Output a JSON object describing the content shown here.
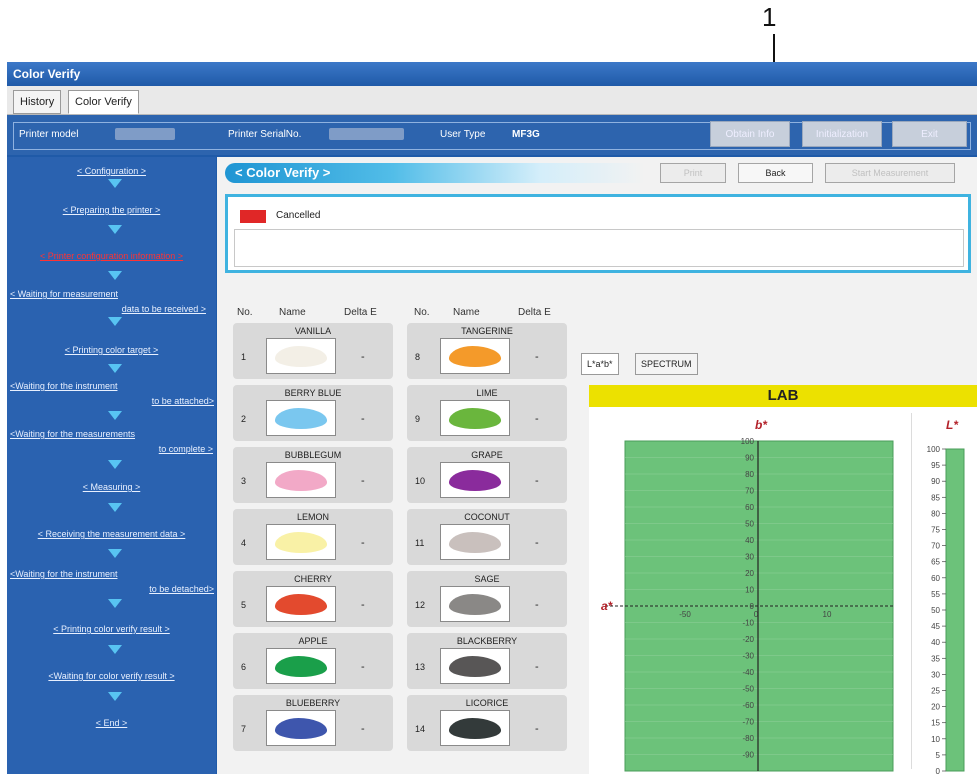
{
  "callout": {
    "number": "1"
  },
  "window": {
    "title": "Color Verify"
  },
  "tabs": [
    "History",
    "Color Verify"
  ],
  "infobar": {
    "printer_model_label": "Printer model",
    "printer_serial_label": "Printer SerialNo.",
    "user_type_label": "User Type",
    "user_type_value": "MF3G",
    "buttons": [
      "Obtain Info",
      "Initialization",
      "Exit"
    ]
  },
  "sidebar": {
    "steps": [
      "<   Configuration   >",
      "<  Preparing the printer  >",
      "< Printer configuration information >",
      "< Waiting for measurement",
      "data to be received   >",
      "<  Printing color target  >",
      "<Waiting for the instrument",
      "to be attached>",
      "<Waiting for the measurements",
      "to complete >",
      "<     Measuring     >",
      "< Receiving the measurement data >",
      "<Waiting for the instrument",
      "to be detached>",
      "< Printing color verify result >",
      "<Waiting for color verify result >",
      "<      End      >"
    ]
  },
  "content": {
    "banner": "< Color Verify >",
    "buttons": {
      "print": "Print",
      "back": "Back",
      "start": "Start Measurement"
    },
    "status": {
      "text": "Cancelled",
      "color": "#e02727"
    },
    "headers": {
      "no": "No.",
      "name": "Name",
      "delta": "Delta E"
    }
  },
  "swatches": [
    {
      "no": "1",
      "name": "VANILLA",
      "de": "-",
      "color": "#f3efe6"
    },
    {
      "no": "2",
      "name": "BERRY BLUE",
      "de": "-",
      "color": "#7ac7ef"
    },
    {
      "no": "3",
      "name": "BUBBLEGUM",
      "de": "-",
      "color": "#f2a9c7"
    },
    {
      "no": "4",
      "name": "LEMON",
      "de": "-",
      "color": "#f9f1a6"
    },
    {
      "no": "5",
      "name": "CHERRY",
      "de": "-",
      "color": "#e34a2e"
    },
    {
      "no": "6",
      "name": "APPLE",
      "de": "-",
      "color": "#1a9f4a"
    },
    {
      "no": "7",
      "name": "BLUEBERRY",
      "de": "-",
      "color": "#3e56ad"
    },
    {
      "no": "8",
      "name": "TANGERINE",
      "de": "-",
      "color": "#f49a2a"
    },
    {
      "no": "9",
      "name": "LIME",
      "de": "-",
      "color": "#6ab63d"
    },
    {
      "no": "10",
      "name": "GRAPE",
      "de": "-",
      "color": "#8a2b9c"
    },
    {
      "no": "11",
      "name": "COCONUT",
      "de": "-",
      "color": "#c9c0bd"
    },
    {
      "no": "12",
      "name": "SAGE",
      "de": "-",
      "color": "#8a8886"
    },
    {
      "no": "13",
      "name": "BLACKBERRY",
      "de": "-",
      "color": "#585656"
    },
    {
      "no": "14",
      "name": "LICORICE",
      "de": "-",
      "color": "#333a3a"
    }
  ],
  "chart": {
    "tabs": [
      "L*a*b*",
      "SPECTRUM"
    ],
    "title": "LAB",
    "b_label": "b*",
    "a_label": "a*",
    "l_label": "L*",
    "plot_color": "#6cc27a",
    "b_ticks": [
      "100",
      "90",
      "80",
      "70",
      "60",
      "50",
      "40",
      "30",
      "20",
      "10",
      "0",
      "-10",
      "-20",
      "-30",
      "-40",
      "-50",
      "-60",
      "-70",
      "-80",
      "-90"
    ],
    "a_ticks": [
      "-50",
      "0",
      "10"
    ],
    "l_ticks": [
      "100",
      "95",
      "90",
      "85",
      "80",
      "75",
      "70",
      "65",
      "60",
      "55",
      "50",
      "45",
      "40",
      "35",
      "30",
      "25",
      "20",
      "15",
      "10",
      "5",
      "0"
    ]
  }
}
